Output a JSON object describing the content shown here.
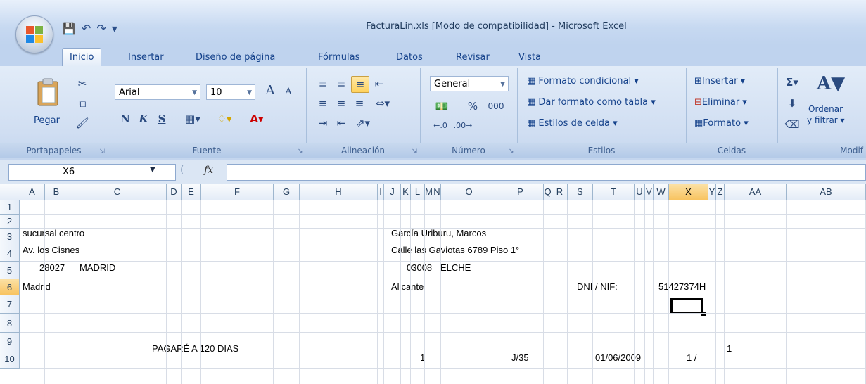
{
  "window": {
    "title": "FacturaLin.xls  [Modo de compatibilidad] - Microsoft Excel"
  },
  "quick_access": {
    "save_icon": "save-icon",
    "undo_icon": "undo-icon",
    "redo_icon": "redo-icon",
    "customize_icon": "customize-icon"
  },
  "tabs": [
    {
      "label": "Inicio",
      "active": true
    },
    {
      "label": "Insertar"
    },
    {
      "label": "Diseño de página"
    },
    {
      "label": "Fórmulas"
    },
    {
      "label": "Datos"
    },
    {
      "label": "Revisar"
    },
    {
      "label": "Vista"
    }
  ],
  "ribbon": {
    "clipboard": {
      "label": "Portapapeles",
      "paste": "Pegar"
    },
    "font": {
      "label": "Fuente",
      "family": "Arial",
      "size": "10",
      "bold": "N",
      "italic": "K",
      "underline": "S",
      "grow": "A",
      "shrink": "A"
    },
    "alignment": {
      "label": "Alineación"
    },
    "number": {
      "label": "Número",
      "format": "General",
      "percent": "%",
      "thousands": "000"
    },
    "styles": {
      "label": "Estilos",
      "conditional": "Formato condicional",
      "as_table": "Dar formato como tabla",
      "cell_styles": "Estilos de celda"
    },
    "cells": {
      "label": "Celdas",
      "insert": "Insertar",
      "delete": "Eliminar",
      "format": "Formato"
    },
    "editing": {
      "label": "Modif",
      "sort": "Ordenar",
      "filter": "y filtrar",
      "sigma": "Σ"
    }
  },
  "formula_bar": {
    "name_box": "X6",
    "fx": "fx",
    "value": ""
  },
  "columns": [
    "A",
    "B",
    "C",
    "D",
    "E",
    "F",
    "G",
    "H",
    "I",
    "J",
    "K",
    "L",
    "M",
    "N",
    "O",
    "P",
    "Q",
    "R",
    "S",
    "T",
    "U",
    "V",
    "W",
    "X",
    "Y",
    "Z",
    "AA",
    "AB"
  ],
  "selected_column": "X",
  "rows": [
    "1",
    "2",
    "3",
    "4",
    "5",
    "6",
    "7",
    "8",
    "9",
    "10"
  ],
  "selected_row": "6",
  "cells": {
    "r2_left": "sucursal centro",
    "r2_right": "García Uriburu, Marcos",
    "r3_left": "Av. los Cisnes",
    "r3_right": "Calle las Gaviotas 6789 Piso 1°",
    "r4_zip_left": "28027",
    "r4_city_left": "MADRID",
    "r4_zip_right": "03008",
    "r4_city_right": "ELCHE",
    "r5_left": "Madrid",
    "r5_right": "Alicante",
    "r5_dni_label": "DNI / NIF:",
    "r5_dni_value": "51427374H",
    "r8_9_title": "PAGARÉ A 120 DIAS",
    "r9_num": "1",
    "r9_code": "J/35",
    "r9_date": "01/06/2009",
    "r9_page": "1 /",
    "r8_9_page_total": "1"
  }
}
